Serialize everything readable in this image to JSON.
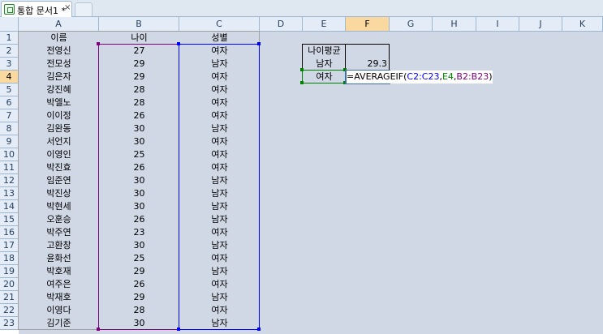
{
  "tab": {
    "title": "통합 문서1 *",
    "close": "×"
  },
  "columns": [
    "A",
    "B",
    "C",
    "D",
    "E",
    "F",
    "G",
    "H",
    "I",
    "J",
    "K"
  ],
  "rows": [
    "1",
    "2",
    "3",
    "4",
    "5",
    "6",
    "7",
    "8",
    "9",
    "10",
    "11",
    "12",
    "13",
    "14",
    "15",
    "16",
    "17",
    "18",
    "19",
    "20",
    "21",
    "22",
    "23"
  ],
  "table": {
    "headers": [
      "이름",
      "나이",
      "성별"
    ],
    "data": [
      [
        "전영신",
        "27",
        "여자"
      ],
      [
        "전모성",
        "29",
        "남자"
      ],
      [
        "김은자",
        "29",
        "여자"
      ],
      [
        "강진혜",
        "28",
        "여자"
      ],
      [
        "박엘노",
        "28",
        "여자"
      ],
      [
        "이이정",
        "26",
        "여자"
      ],
      [
        "김완동",
        "30",
        "남자"
      ],
      [
        "서언지",
        "30",
        "여자"
      ],
      [
        "이영인",
        "25",
        "여자"
      ],
      [
        "박진효",
        "26",
        "여자"
      ],
      [
        "임준연",
        "30",
        "남자"
      ],
      [
        "박진상",
        "30",
        "남자"
      ],
      [
        "박현세",
        "30",
        "남자"
      ],
      [
        "오훈승",
        "26",
        "남자"
      ],
      [
        "박주연",
        "23",
        "여자"
      ],
      [
        "고환창",
        "30",
        "남자"
      ],
      [
        "윤화선",
        "25",
        "여자"
      ],
      [
        "박호재",
        "29",
        "남자"
      ],
      [
        "여주은",
        "26",
        "여자"
      ],
      [
        "박재호",
        "29",
        "남자"
      ],
      [
        "이영다",
        "28",
        "여자"
      ],
      [
        "김기준",
        "30",
        "남자"
      ]
    ]
  },
  "summary": {
    "title": "나이평균",
    "male_label": "남자",
    "male_value": "29.3",
    "female_label": "여자"
  },
  "formula": {
    "prefix": "=AVERAGEIF(",
    "arg1": "C2:C23",
    "sep1": ",",
    "arg2": "E4",
    "sep2": ",",
    "arg3": "B2:B23",
    "suffix": ")"
  },
  "selection": {
    "column": "F",
    "row": "4"
  },
  "colors": {
    "range_c": "#0000ff",
    "range_e": "#008000",
    "range_b": "#800080",
    "header_bg": "#e4ecf7",
    "selected_header_bg": "#f9d99f"
  }
}
